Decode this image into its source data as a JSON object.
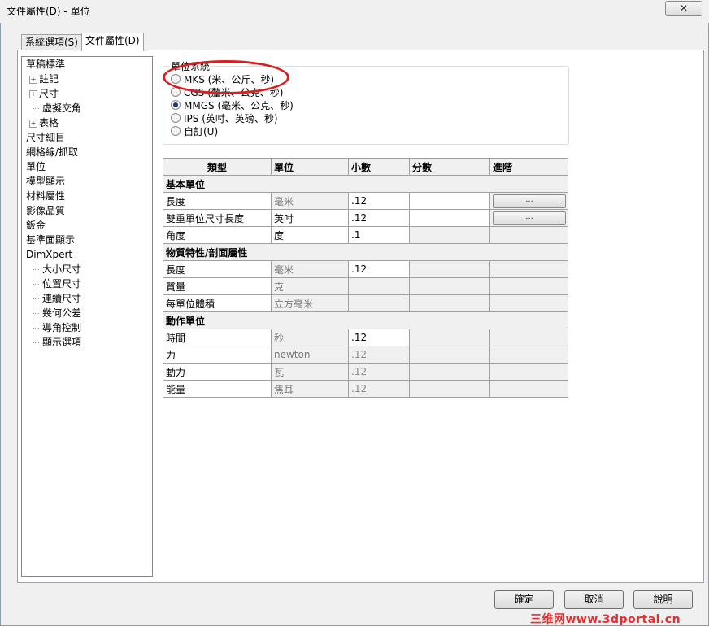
{
  "window": {
    "title": "文件屬性(D) - 單位",
    "close_glyph": "✕"
  },
  "tabs": [
    {
      "label": "系統選項(S)",
      "active": false
    },
    {
      "label": "文件屬性(D)",
      "active": true
    }
  ],
  "tree": {
    "items": [
      {
        "label": "草稿標準",
        "expandable": false
      },
      {
        "label": "註記",
        "expandable": true
      },
      {
        "label": "尺寸",
        "expandable": true
      },
      {
        "label": "虛擬交角",
        "expandable": false
      },
      {
        "label": "表格",
        "expandable": true
      },
      {
        "label": "尺寸細目",
        "expandable": false
      },
      {
        "label": "網格線/抓取",
        "expandable": false
      },
      {
        "label": "單位",
        "expandable": false
      },
      {
        "label": "模型顯示",
        "expandable": false
      },
      {
        "label": "材料屬性",
        "expandable": false
      },
      {
        "label": "影像品質",
        "expandable": false
      },
      {
        "label": "鈑金",
        "expandable": false
      },
      {
        "label": "基準面顯示",
        "expandable": false
      },
      {
        "label": "DimXpert",
        "expandable": false
      },
      {
        "label": "大小尺寸",
        "expandable": false
      },
      {
        "label": "位置尺寸",
        "expandable": false
      },
      {
        "label": "連續尺寸",
        "expandable": false
      },
      {
        "label": "幾何公差",
        "expandable": false
      },
      {
        "label": "導角控制",
        "expandable": false
      },
      {
        "label": "顯示選項",
        "expandable": false
      }
    ],
    "plus_glyph": "+"
  },
  "unit_system": {
    "label": "單位系統",
    "options": [
      {
        "label": "MKS (米、公斤、秒)",
        "checked": false
      },
      {
        "label": "CGS (釐米、公克、秒)",
        "checked": false
      },
      {
        "label": "MMGS (毫米、公克、秒)",
        "checked": true
      },
      {
        "label": "IPS (英吋、英磅、秒)",
        "checked": false
      },
      {
        "label": "自訂(U)",
        "checked": false
      }
    ]
  },
  "table": {
    "headers": [
      "類型",
      "單位",
      "小數",
      "分數",
      "進階"
    ],
    "sections": [
      {
        "title": "基本單位",
        "rows": [
          {
            "type": "長度",
            "unit": "毫米",
            "decimal": ".12",
            "has_button": true
          },
          {
            "type": "雙重單位尺寸長度",
            "unit": "英吋",
            "decimal": ".12",
            "has_button": true
          },
          {
            "type": "角度",
            "unit": "度",
            "decimal": ".1",
            "has_button": false
          }
        ]
      },
      {
        "title": "物質特性/剖面屬性",
        "rows": [
          {
            "type": "長度",
            "unit": "毫米",
            "decimal": ".12",
            "has_button": false
          },
          {
            "type": "質量",
            "unit": "克",
            "decimal": "",
            "has_button": false
          },
          {
            "type": "每單位體積",
            "unit": "立方毫米",
            "decimal": "",
            "has_button": false
          }
        ]
      },
      {
        "title": "動作單位",
        "rows": [
          {
            "type": "時間",
            "unit": "秒",
            "decimal": ".12",
            "has_button": false
          },
          {
            "type": "力",
            "unit": "newton",
            "decimal": ".12",
            "has_button": false
          },
          {
            "type": "動力",
            "unit": "瓦",
            "decimal": ".12",
            "has_button": false
          },
          {
            "type": "能量",
            "unit": "焦耳",
            "decimal": ".12",
            "has_button": false
          }
        ]
      }
    ],
    "ellipsis": "..."
  },
  "buttons": {
    "ok": "確定",
    "cancel": "取消",
    "help": "說明"
  },
  "watermark": "三维网www.3dportal.cn",
  "colors": {
    "annotation_oval": "#d81e1e",
    "watermark": "#e03030"
  }
}
